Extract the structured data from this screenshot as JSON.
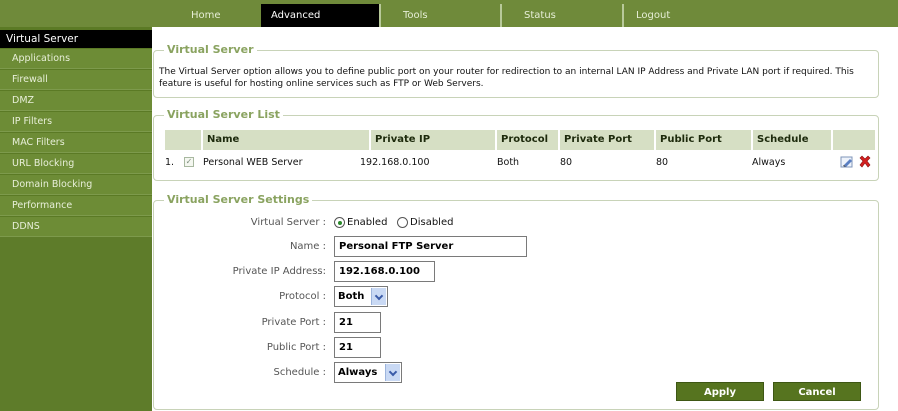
{
  "nav": {
    "tabs": [
      {
        "label": "Home"
      },
      {
        "label": "Advanced"
      },
      {
        "label": "Tools"
      },
      {
        "label": "Status"
      },
      {
        "label": "Logout"
      }
    ],
    "active": "Advanced"
  },
  "sidebar": {
    "header": "Virtual Server",
    "items": [
      {
        "label": "Applications"
      },
      {
        "label": "Firewall"
      },
      {
        "label": "DMZ"
      },
      {
        "label": "IP Filters"
      },
      {
        "label": "MAC Filters"
      },
      {
        "label": "URL Blocking"
      },
      {
        "label": "Domain Blocking"
      },
      {
        "label": "Performance"
      },
      {
        "label": "DDNS"
      }
    ]
  },
  "intro": {
    "title": "Virtual Server",
    "description": "The Virtual Server option allows you to define public port on your router for redirection to an internal LAN IP Address and Private LAN port if required. This feature is useful for hosting online services such as FTP or Web Servers."
  },
  "list": {
    "title": "Virtual Server List",
    "columns": [
      "Name",
      "Private IP",
      "Protocol",
      "Private Port",
      "Public Port",
      "Schedule"
    ],
    "rows": [
      {
        "index": "1.",
        "checked": true,
        "name": "Personal WEB Server",
        "private_ip": "192.168.0.100",
        "protocol": "Both",
        "private_port": "80",
        "public_port": "80",
        "schedule": "Always",
        "edit_icon": "edit-icon",
        "delete_icon": "delete-icon"
      }
    ]
  },
  "settings": {
    "title": "Virtual Server Settings",
    "virtual_server_label": "Virtual Server :",
    "enabled_label": "Enabled",
    "disabled_label": "Disabled",
    "enabled": true,
    "name_label": "Name :",
    "name_value": "Personal FTP Server",
    "private_ip_label": "Private IP Address:",
    "private_ip_value": "192.168.0.100",
    "protocol_label": "Protocol :",
    "protocol_value": "Both",
    "private_port_label": "Private Port :",
    "private_port_value": "21",
    "public_port_label": "Public Port :",
    "public_port_value": "21",
    "schedule_label": "Schedule :",
    "schedule_value": "Always",
    "apply_label": "Apply",
    "cancel_label": "Cancel"
  },
  "colors": {
    "accent_green": "#6f8a3a",
    "button_green": "#56741f",
    "legend_green": "#8aa360"
  }
}
